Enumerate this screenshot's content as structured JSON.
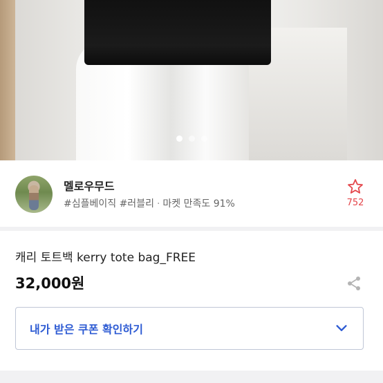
{
  "carousel": {
    "total": 3,
    "active_index": 0
  },
  "seller": {
    "name": "멜로우무드",
    "tags": "#심플베이직 #러블리",
    "satisfaction": "마켓 만족도 91%",
    "favorite_count": "752"
  },
  "product": {
    "title": "캐리 토트백 kerry tote bag_FREE",
    "price": "32,000원"
  },
  "coupon": {
    "label": "내가 받은 쿠폰 확인하기"
  },
  "colors": {
    "accent": "#e4464b",
    "link": "#2d5bd3"
  }
}
